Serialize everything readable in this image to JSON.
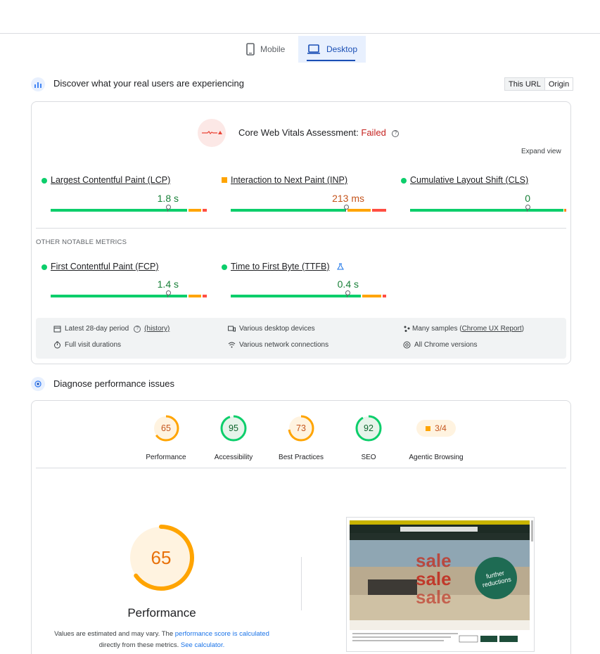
{
  "tabs": {
    "mobile": "Mobile",
    "desktop": "Desktop"
  },
  "field": {
    "title": "Discover what your real users are experiencing",
    "toggle": {
      "this_url": "This URL",
      "origin": "Origin"
    },
    "assessment_prefix": "Core Web Vitals Assessment:",
    "assessment_status": "Failed",
    "help": "?",
    "expand": "Expand view",
    "metrics": [
      {
        "name": "Largest Contentful Paint (LCP)",
        "value": "1.8 s"
      },
      {
        "name": "Interaction to Next Paint (INP)",
        "value": "213 ms"
      },
      {
        "name": "Cumulative Layout Shift (CLS)",
        "value": "0"
      }
    ],
    "other_label": "OTHER NOTABLE METRICS",
    "other_metrics": [
      {
        "name": "First Contentful Paint (FCP)",
        "value": "1.4 s"
      },
      {
        "name": "Time to First Byte (TTFB)",
        "value": "0.4 s"
      }
    ],
    "info": {
      "period": "Latest 28-day period",
      "history": "(history)",
      "durations": "Full visit durations",
      "devices": "Various desktop devices",
      "network": "Various network connections",
      "samples_prefix": "Many samples (",
      "samples_link": "Chrome UX Report",
      "samples_suffix": ")",
      "versions": "All Chrome versions"
    }
  },
  "lab": {
    "title": "Diagnose performance issues",
    "scores": [
      {
        "label": "Performance",
        "value": "65",
        "fraction": 0.65
      },
      {
        "label": "Accessibility",
        "value": "95",
        "fraction": 0.95
      },
      {
        "label": "Best Practices",
        "value": "73",
        "fraction": 0.73
      },
      {
        "label": "SEO",
        "value": "92",
        "fraction": 0.92
      },
      {
        "label": "Agentic Browsing",
        "value": "3/4"
      }
    ],
    "big_score": "65",
    "big_label": "Performance",
    "note_1": "Values are estimated and may vary. The ",
    "note_link_1": "performance score is calculated",
    "note_2": "directly from these metrics. ",
    "note_link_2": "See calculator."
  },
  "colors": {
    "good": "#0cce6b",
    "average": "#ffa400",
    "poor": "#ff4e42",
    "accent": "#1a4fb5"
  },
  "screenshot": {
    "overlay_text_1": "further",
    "overlay_text_2": "reductions",
    "sale_text": "sale"
  }
}
